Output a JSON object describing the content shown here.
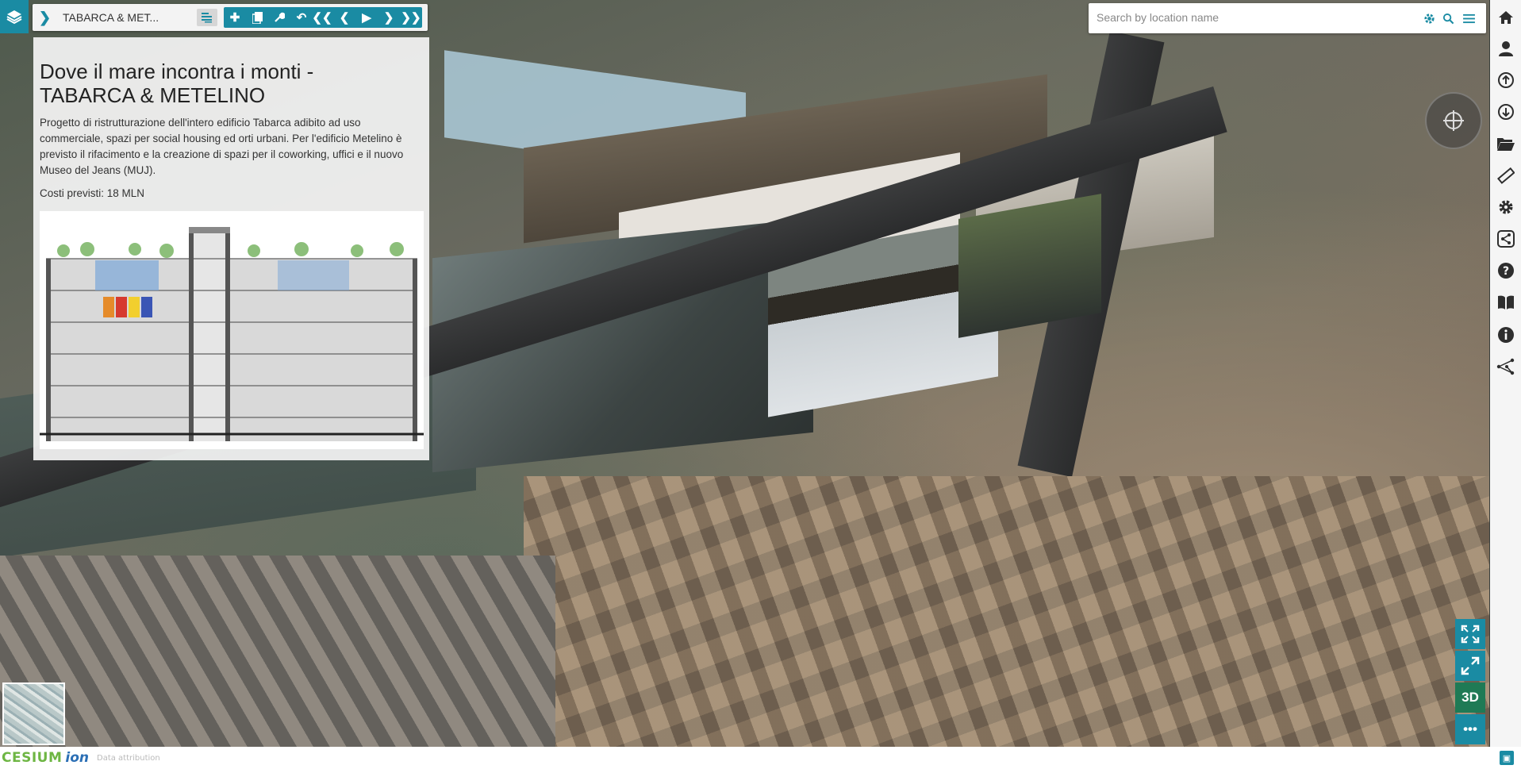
{
  "toolbar": {
    "story_title": "TABARCA & MET...",
    "buttons": [
      "plus-icon",
      "copy-icon",
      "wrench-icon",
      "undo-icon",
      "redo-icon"
    ],
    "nav_buttons": [
      "first-icon",
      "previous-icon",
      "play-icon",
      "next-icon",
      "last-icon"
    ]
  },
  "story": {
    "title": "Dove il mare incontra i monti - TABARCA & METELINO",
    "description": "Progetto di ristrutturazione dell'intero edificio Tabarca adibito ad uso commerciale, spazi per social housing ed orti urbani. Per l'edificio Metelino è previsto il rifacimento e la creazione di spazi per il coworking, uffici e il nuovo Museo del Jeans (MUJ).",
    "cost": "Costi previsti: 18 MLN"
  },
  "search": {
    "placeholder": "Search by location name"
  },
  "right_toolbar": [
    "home-icon",
    "user-icon",
    "upload-icon",
    "download-icon",
    "folder-icon",
    "measure-icon",
    "settings-icon",
    "share-icon",
    "help-icon",
    "guide-icon",
    "info-icon",
    "network-icon"
  ],
  "view_controls": {
    "mode_label": "3D",
    "more_label": "•••"
  },
  "footer": {
    "brand": "CESIUM",
    "brand_suffix": "ion",
    "attribution": "Data attribution"
  },
  "colors": {
    "accent": "#1a8ba3",
    "mode_3d": "#1f7a55"
  }
}
